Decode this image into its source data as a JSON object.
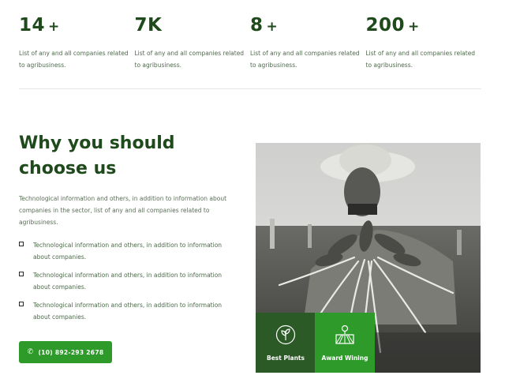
{
  "stats": [
    {
      "number": "14",
      "suffix": "+",
      "desc": "List of any and all companies related to agribusiness."
    },
    {
      "number": "7K",
      "suffix": "",
      "desc": "List of any and all companies related to agribusiness."
    },
    {
      "number": "8",
      "suffix": "+",
      "desc": "List of any and all companies related to agribusiness."
    },
    {
      "number": "200",
      "suffix": "+",
      "desc": "List of any and all companies related to agribusiness."
    }
  ],
  "why": {
    "heading": "Why you should choose us",
    "intro": "Technological information and others, in addition to information about companies in the sector, list of any and all companies related to agribusiness.",
    "bullets": [
      "Technological information and others, in addition to information about companies.",
      "Technological information and others, in addition to information about companies.",
      "Technological information and others, in addition to information about companies."
    ]
  },
  "cta": {
    "phone_icon": "phone-icon",
    "label": "(10) 892-293 2678"
  },
  "badges": [
    {
      "icon": "plant-icon",
      "label": "Best Plants"
    },
    {
      "icon": "award-farm-icon",
      "label": "Award Wining"
    }
  ],
  "colors": {
    "brand_dark": "#1e4a1c",
    "brand_green": "#2e9a2a",
    "badge_dark": "#2b5a26"
  }
}
